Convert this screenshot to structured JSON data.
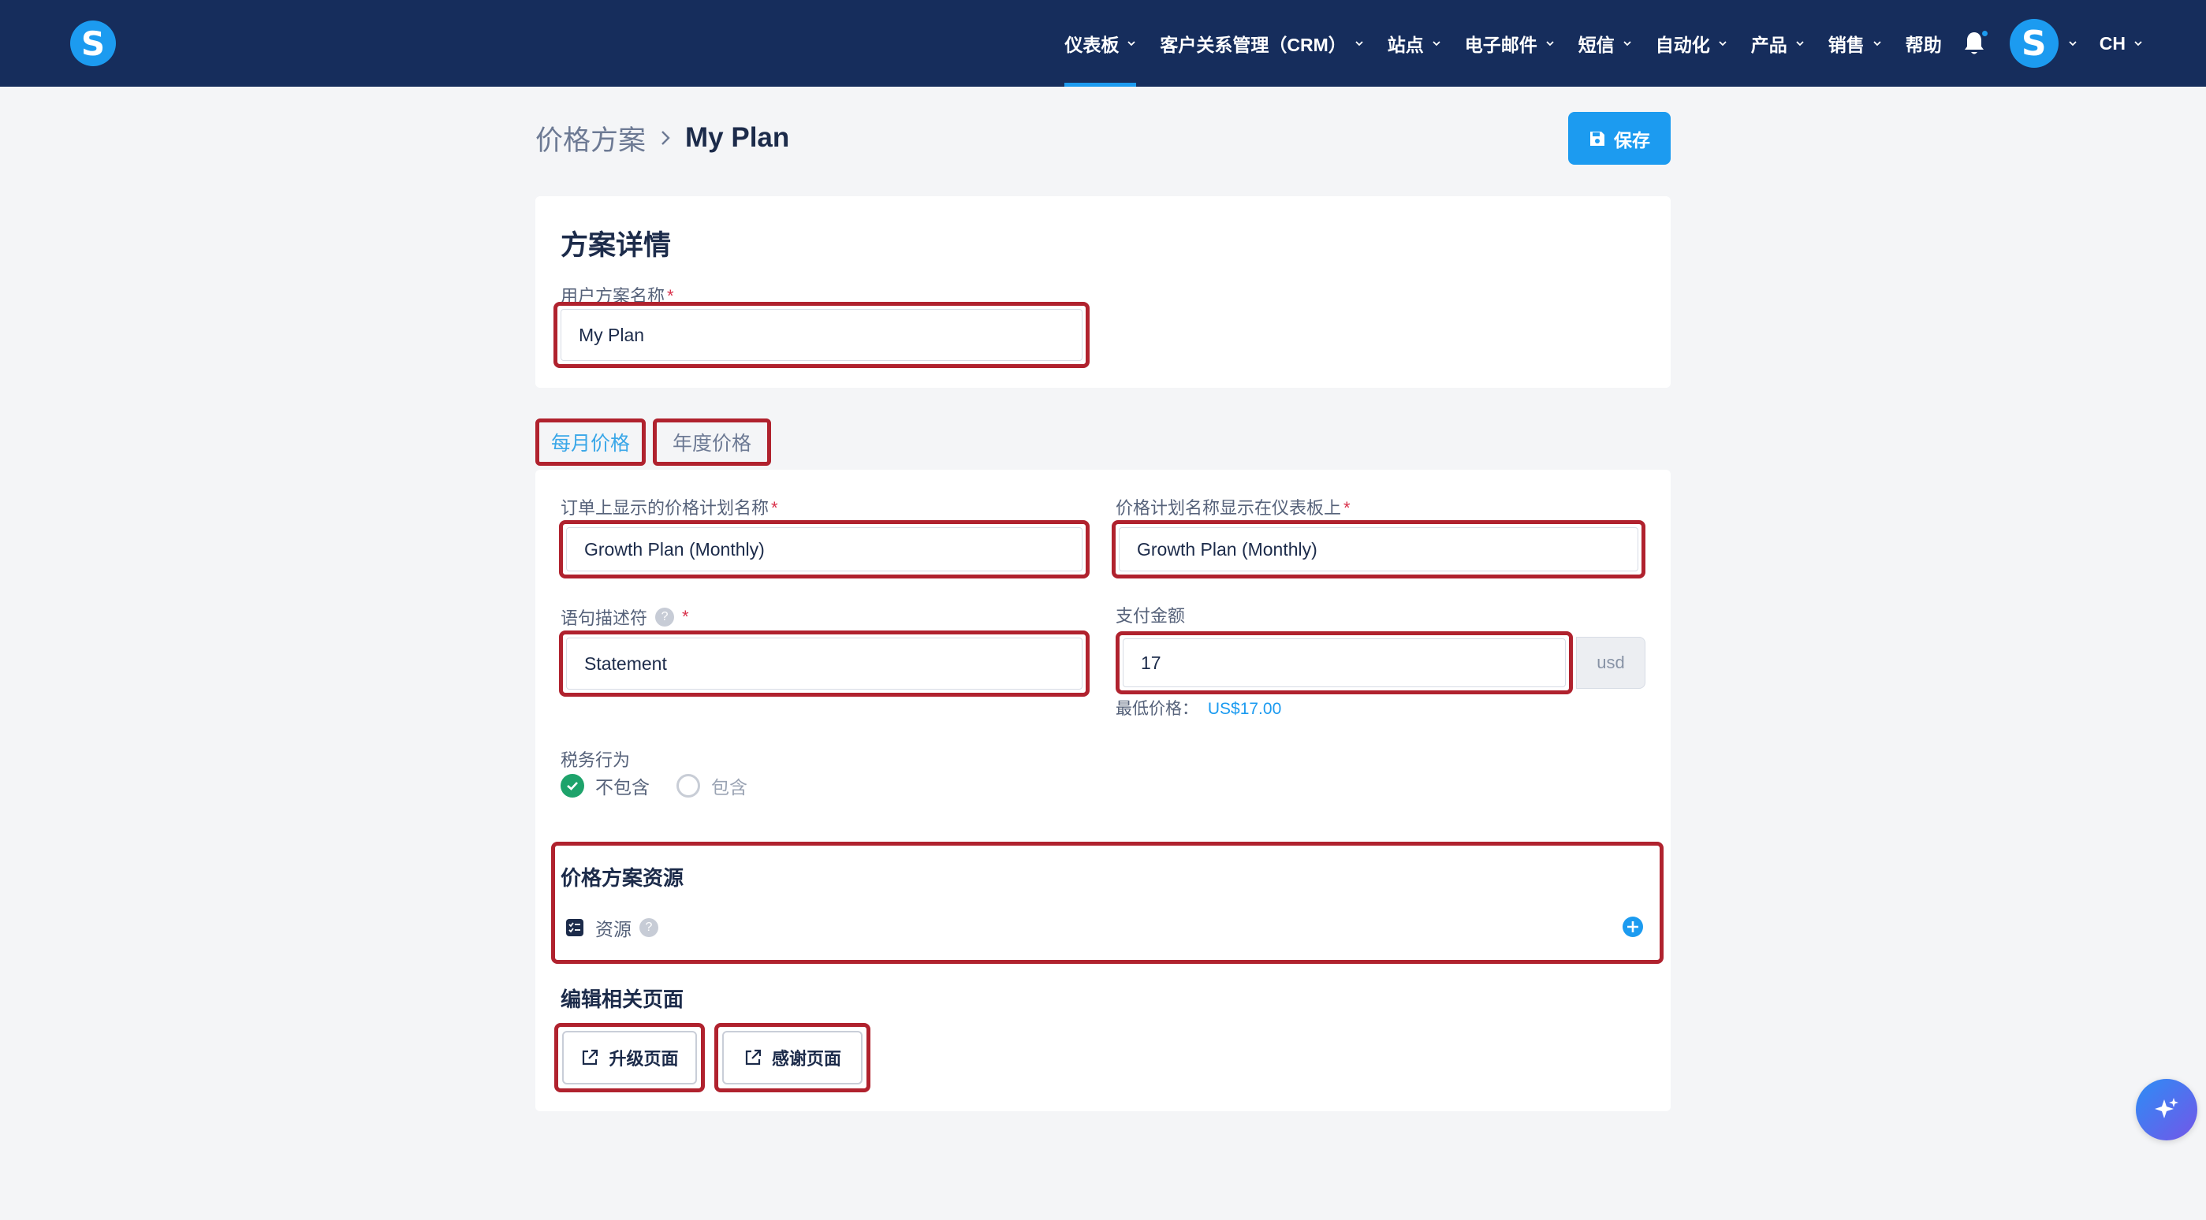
{
  "nav": {
    "logo_letter": "S",
    "menu": [
      {
        "label": "仪表板",
        "active": true
      },
      {
        "label": "客户关系管理（CRM）"
      },
      {
        "label": "站点"
      },
      {
        "label": "电子邮件"
      },
      {
        "label": "短信"
      },
      {
        "label": "自动化"
      },
      {
        "label": "产品"
      },
      {
        "label": "销售"
      }
    ],
    "help": "帮助",
    "avatar_letter": "S",
    "language": "CH"
  },
  "breadcrumb": {
    "root": "价格方案",
    "current": "My Plan"
  },
  "toolbar": {
    "save_label": "保存"
  },
  "plan_details": {
    "title": "方案详情",
    "name_label": "用户方案名称",
    "name_value": "My Plan"
  },
  "tabs": [
    {
      "label": "每月价格",
      "active": true
    },
    {
      "label": "年度价格",
      "active": false
    }
  ],
  "pricing": {
    "order_name_label": "订单上显示的价格计划名称",
    "order_name_value": "Growth Plan (Monthly)",
    "dashboard_name_label": "价格计划名称显示在仪表板上",
    "dashboard_name_value": "Growth Plan (Monthly)",
    "descriptor_label": "语句描述符",
    "descriptor_value": "Statement",
    "amount_label": "支付金额",
    "amount_value": "17",
    "currency": "usd",
    "min_price_label": "最低价格：",
    "min_price_value": "US$17.00",
    "tax_label": "税务行为",
    "tax_options": [
      {
        "label": "不包含",
        "selected": true
      },
      {
        "label": "包含",
        "selected": false
      }
    ]
  },
  "resources": {
    "title": "价格方案资源",
    "item_label": "资源"
  },
  "related_pages": {
    "title": "编辑相关页面",
    "upgrade_label": "升级页面",
    "thanks_label": "感谢页面"
  },
  "colors": {
    "nav_bg": "#162d5c",
    "accent": "#1c9bf0",
    "highlight_border": "#b0222e",
    "success": "#1ea36b"
  }
}
